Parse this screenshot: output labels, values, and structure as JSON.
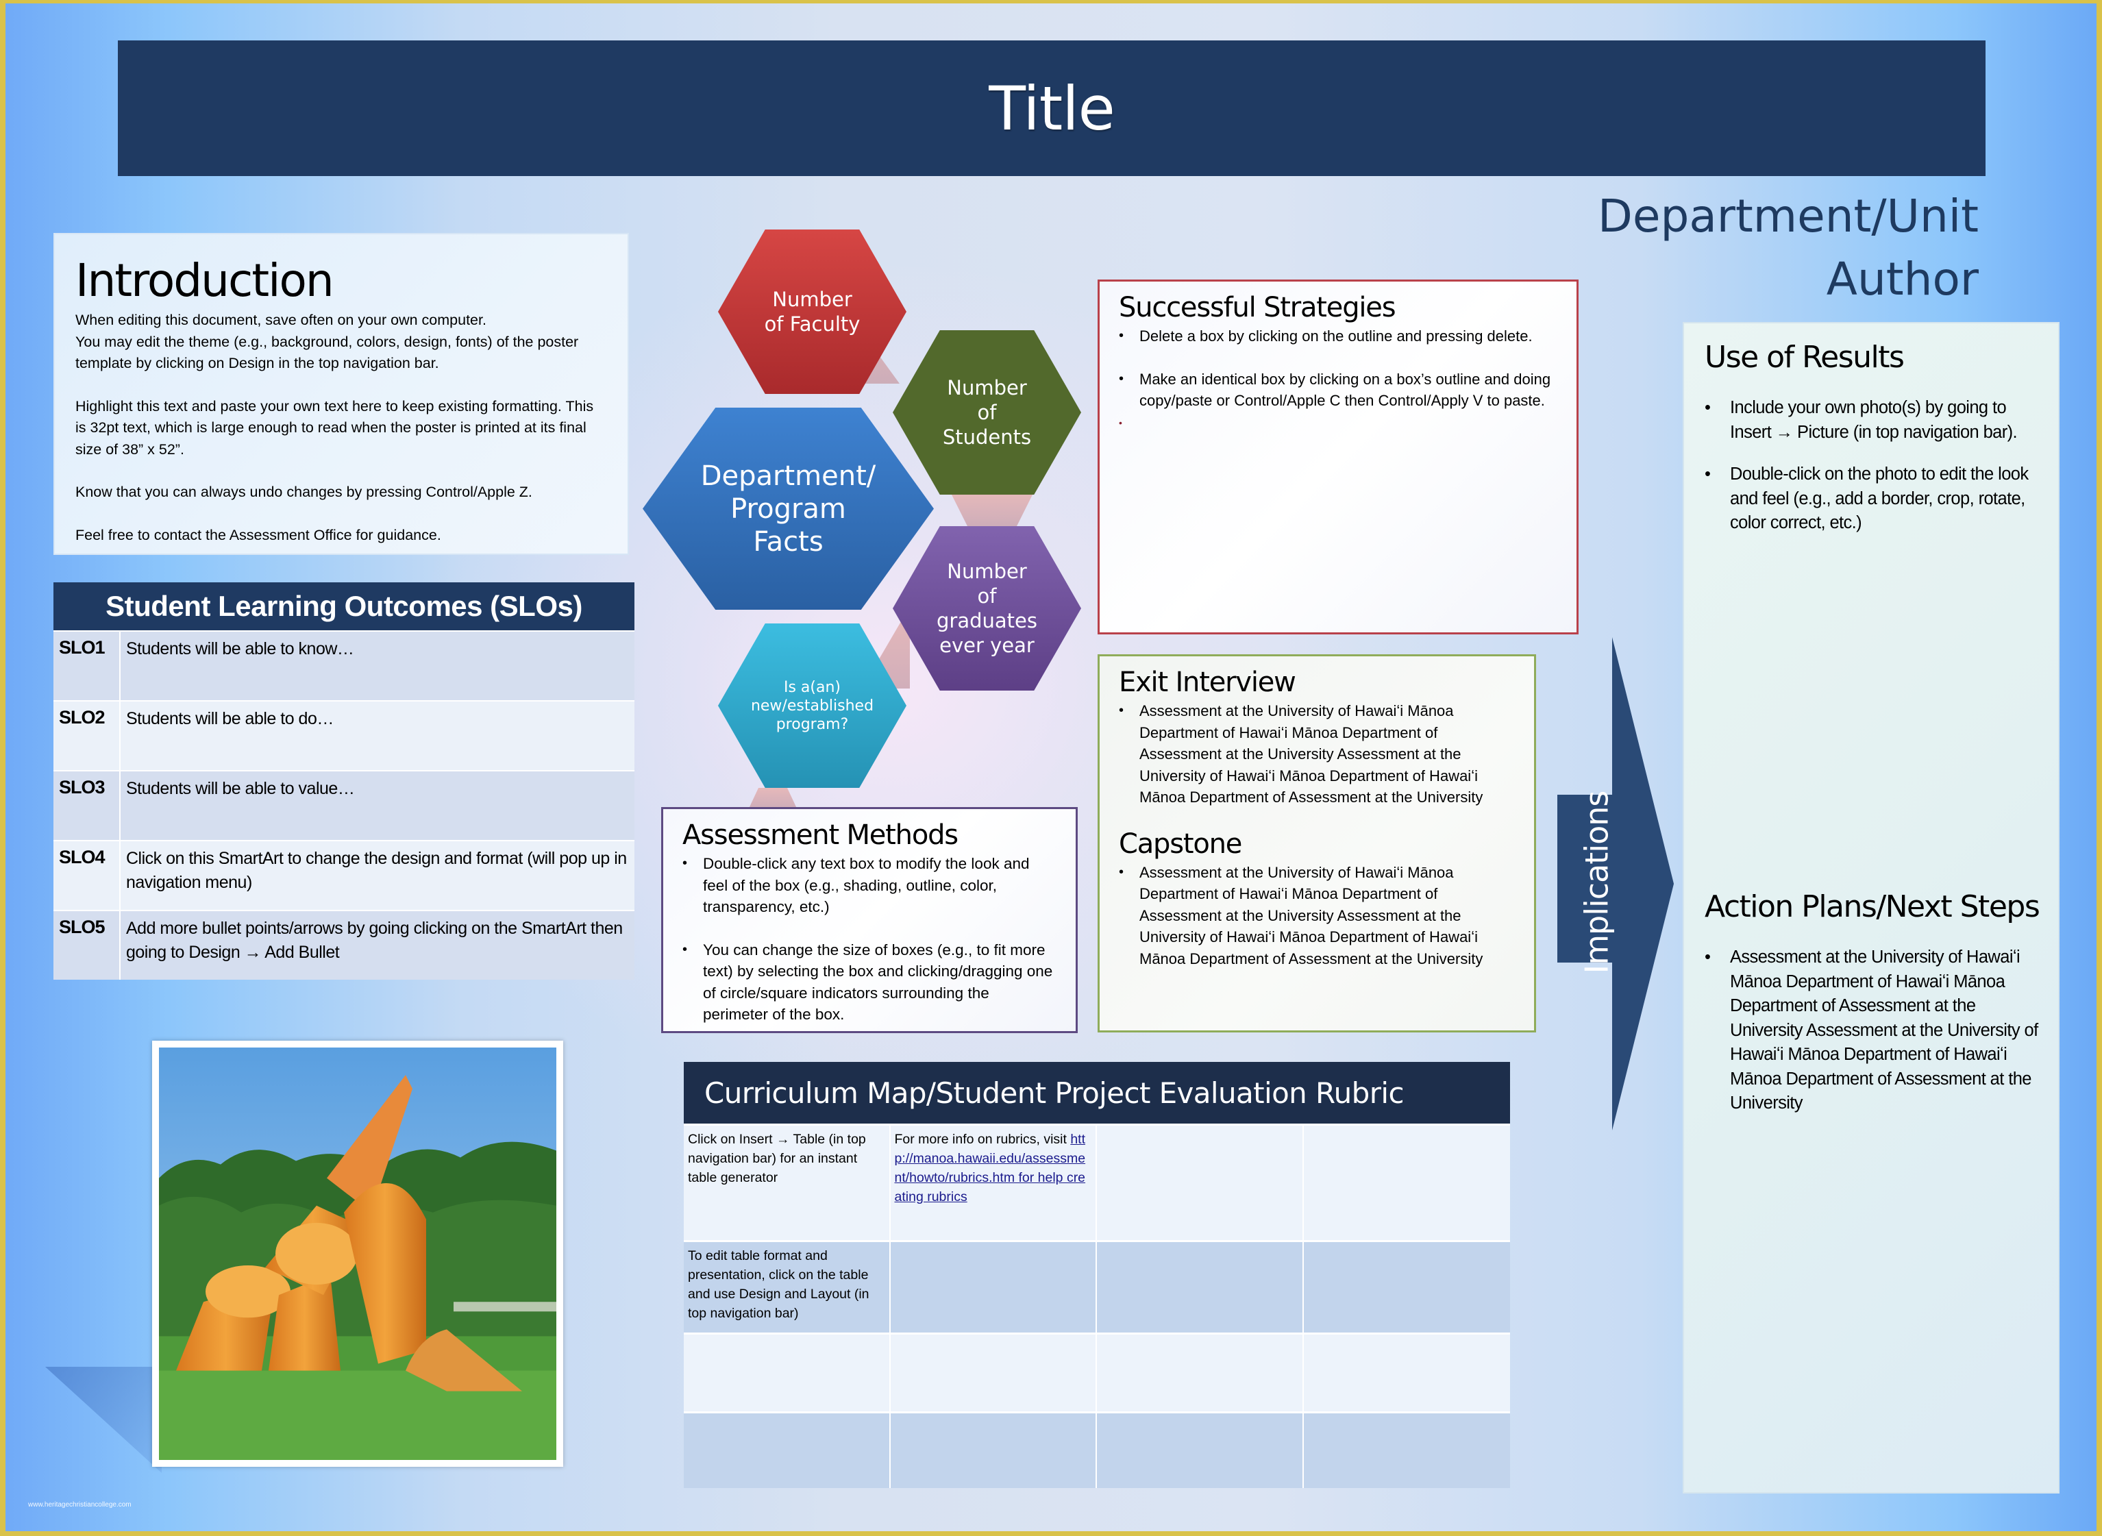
{
  "title": "Title",
  "department_unit": "Department/Unit",
  "author": "Author",
  "introduction": {
    "heading": "Introduction",
    "paragraphs": [
      [
        "When editing this document, save often on your own computer.",
        "You may edit the theme (e.g., background, colors, design, fonts) of the poster template by clicking on Design in the top navigation bar."
      ],
      [
        "Highlight this text and paste your own text here to keep existing formatting. This is 32pt text, which is large enough to read when the poster is printed at its final size of 38” x 52”."
      ],
      [
        "Know that you can always undo changes by pressing Control/Apple Z."
      ],
      [
        "Feel free to contact the Assessment Office for guidance."
      ]
    ]
  },
  "slo": {
    "heading": "Student Learning Outcomes (SLOs)",
    "rows": [
      {
        "code": "SLO1",
        "text": "Students will be able to know…"
      },
      {
        "code": "SLO2",
        "text": "Students will be able to do…"
      },
      {
        "code": "SLO3",
        "text": "Students will be able to value…"
      },
      {
        "code": "SLO4",
        "text": "Click on this SmartArt to change the design and format (will pop up in navigation menu)"
      },
      {
        "code": "SLO5",
        "text": "Add more bullet points/arrows by going clicking on the SmartArt then going to Design → Add Bullet"
      }
    ]
  },
  "program_facts": {
    "center": "Department/ Program Facts",
    "items": [
      {
        "label": "Number of Faculty",
        "color": "#c8383a"
      },
      {
        "label": "Number of Students",
        "color": "#556b2f"
      },
      {
        "label": "Number of graduates ever year",
        "color": "#6e4e9c"
      },
      {
        "label": "Is a(an) new/established program?",
        "color": "#2aa6c9"
      }
    ],
    "center_color": "#3572bd"
  },
  "successful_strategies": {
    "heading": "Successful Strategies",
    "bullets": [
      "Delete a box by clicking on the outline and pressing delete.",
      "Make an identical box by clicking on a box’s outline and doing copy/paste or Control/Apple C then Control/Apply V to paste."
    ]
  },
  "exit_interview": {
    "heading": "Exit Interview",
    "bullets": [
      "Assessment at the University of Hawaiʻi Mānoa Department of Hawaiʻi Mānoa Department of Assessment at the University Assessment at the University of Hawaiʻi Mānoa Department of Hawaiʻi Mānoa Department of Assessment at the University"
    ]
  },
  "capstone": {
    "heading": "Capstone",
    "bullets": [
      "Assessment at the University of Hawaiʻi Mānoa Department of Hawaiʻi Mānoa Department of Assessment at the University Assessment at the University of Hawaiʻi Mānoa Department of Hawaiʻi Mānoa Department of Assessment at the University"
    ]
  },
  "assessment_methods": {
    "heading": "Assessment Methods",
    "bullets": [
      "Double-click any text box to modify the look and feel of the box (e.g., shading, outline, color, transparency, etc.)",
      "You can change the size of boxes (e.g., to fit more text) by selecting the box and clicking/dragging  one of circle/square indicators surrounding the perimeter of the box."
    ]
  },
  "curriculum": {
    "heading": "Curriculum Map/Student Project Evaluation Rubric",
    "rows": [
      {
        "cells": [
          {
            "text": "Click on Insert → Table (in top navigation bar) for an instant table generator"
          },
          {
            "text": "For more info on rubrics, visit ",
            "link": "http://manoa.hawaii.edu/assessment/howto/rubrics.htm for help creating rubrics"
          },
          {
            "text": ""
          },
          {
            "text": ""
          }
        ]
      },
      {
        "cells": [
          {
            "text": "To edit table format and presentation, click on the table and use Design and Layout (in top navigation bar)"
          },
          {
            "text": ""
          },
          {
            "text": ""
          },
          {
            "text": ""
          }
        ]
      },
      {
        "cells": [
          {
            "text": ""
          },
          {
            "text": ""
          },
          {
            "text": ""
          },
          {
            "text": ""
          }
        ]
      },
      {
        "cells": [
          {
            "text": ""
          },
          {
            "text": ""
          },
          {
            "text": ""
          },
          {
            "text": ""
          }
        ]
      }
    ]
  },
  "implications": {
    "label": "Implications",
    "color": "#2a4a76"
  },
  "use_of_results": {
    "heading": "Use of Results",
    "bullets": [
      "Include your own photo(s) by going to Insert → Picture (in top navigation bar).",
      "Double-click on the photo to edit the look and feel (e.g., add a border, crop,  rotate, color correct, etc.)"
    ]
  },
  "action_plans": {
    "heading": "Action Plans/Next Steps",
    "bullets": [
      "Assessment at the University of Hawaiʻi Mānoa Department of Hawaiʻi Mānoa Department of Assessment at the University Assessment at the University of Hawaiʻi Mānoa Department of Hawaiʻi Mānoa Department of Assessment at the University"
    ]
  },
  "photo": {
    "icon": "sculpture-photo",
    "description": "Orange tubular sculpture on lawn with trees"
  },
  "watermark": "www.heritagechristiancollege.com",
  "colors": {
    "title_bar": "#1f3a62",
    "table_header": "#1d2e4b",
    "strategies_border": "#b9414a",
    "exit_border": "#8fac5a",
    "methods_border": "#5d4a82",
    "page_border": "#d9c24a"
  }
}
